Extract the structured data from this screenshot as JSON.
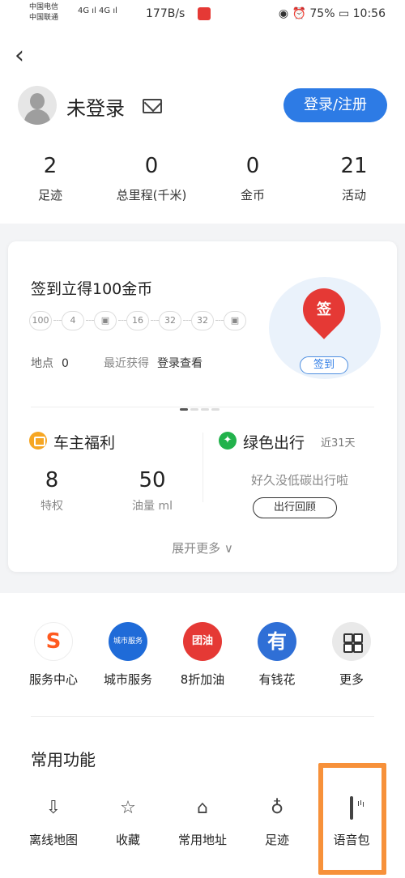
{
  "status_bar": {
    "carrier1": "中国电信",
    "carrier2": "中国联通",
    "network": "4G ıl 4G ıl",
    "speed": "177B/s",
    "battery": "75%",
    "time": "10:56"
  },
  "header": {
    "back_icon": "chevron-left-icon",
    "username": "未登录",
    "login_label": "登录/注册"
  },
  "stats": [
    {
      "value": "2",
      "label": "足迹"
    },
    {
      "value": "0",
      "label": "总里程(千米)"
    },
    {
      "value": "0",
      "label": "金币"
    },
    {
      "value": "21",
      "label": "活动"
    }
  ],
  "checkin": {
    "title": "签到立得100金币",
    "coins": [
      "100",
      "4",
      "",
      "16",
      "32",
      "32",
      ""
    ],
    "location_label": "地点",
    "location_value": "0",
    "recent_label": "最近获得",
    "recent_link": "登录查看",
    "sign_badge": "签",
    "sign_button": "签到"
  },
  "benefits": {
    "title": "车主福利",
    "items": [
      {
        "value": "8",
        "label": "特权"
      },
      {
        "value": "50",
        "label": "油量 ml"
      }
    ]
  },
  "green": {
    "title": "绿色出行",
    "subtitle": "近31天",
    "message": "好久没低碳出行啦",
    "button": "出行回顾"
  },
  "expand_label": "展开更多 ∨",
  "services": [
    {
      "label": "服务中心",
      "icon_text": ""
    },
    {
      "label": "城市服务",
      "icon_text": "城市服务"
    },
    {
      "label": "8折加油",
      "icon_text": "团油"
    },
    {
      "label": "有钱花",
      "icon_text": "有"
    },
    {
      "label": "更多",
      "icon_text": ""
    }
  ],
  "common": {
    "title": "常用功能",
    "tools": [
      {
        "label": "离线地图",
        "icon": "download-map-icon"
      },
      {
        "label": "收藏",
        "icon": "star-icon"
      },
      {
        "label": "常用地址",
        "icon": "home-star-icon"
      },
      {
        "label": "足迹",
        "icon": "footprint-icon"
      },
      {
        "label": "语音包",
        "icon": "voice-pack-icon"
      }
    ]
  },
  "colors": {
    "accent": "#2d7be5",
    "highlight": "#f7913a",
    "sign_red": "#e53935",
    "green": "#22b24c"
  }
}
